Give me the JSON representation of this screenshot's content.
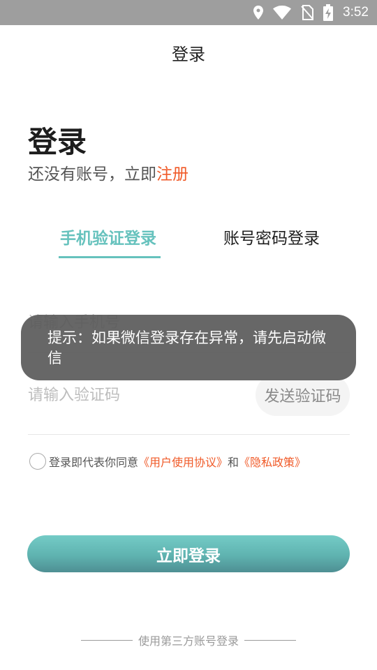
{
  "status_bar": {
    "time": "3:52",
    "icons": [
      "location-icon",
      "wifi-icon",
      "no-sim-icon",
      "battery-charging-icon"
    ]
  },
  "nav": {
    "title": "登录"
  },
  "header": {
    "title": "登录",
    "prompt": "还没有账号，立即",
    "register_link": "注册"
  },
  "tabs": [
    {
      "label": "手机验证登录",
      "active": true
    },
    {
      "label": "账号密码登录",
      "active": false
    }
  ],
  "form": {
    "phone_placeholder": "请输入手机号",
    "code_placeholder": "请输入验证码",
    "send_code_label": "发送验证码"
  },
  "agreement": {
    "text": "登录即代表你同意",
    "user_agreement": "《用户使用协议》",
    "and": "和",
    "privacy_policy": "《隐私政策》"
  },
  "login_button": "立即登录",
  "third_party_label": "使用第三方账号登录",
  "toast": "提示：如果微信登录存在异常，请先启动微信",
  "colors": {
    "accent": "#66c2bd",
    "link": "#f05a28",
    "status_bar": "#9e9e9e"
  }
}
